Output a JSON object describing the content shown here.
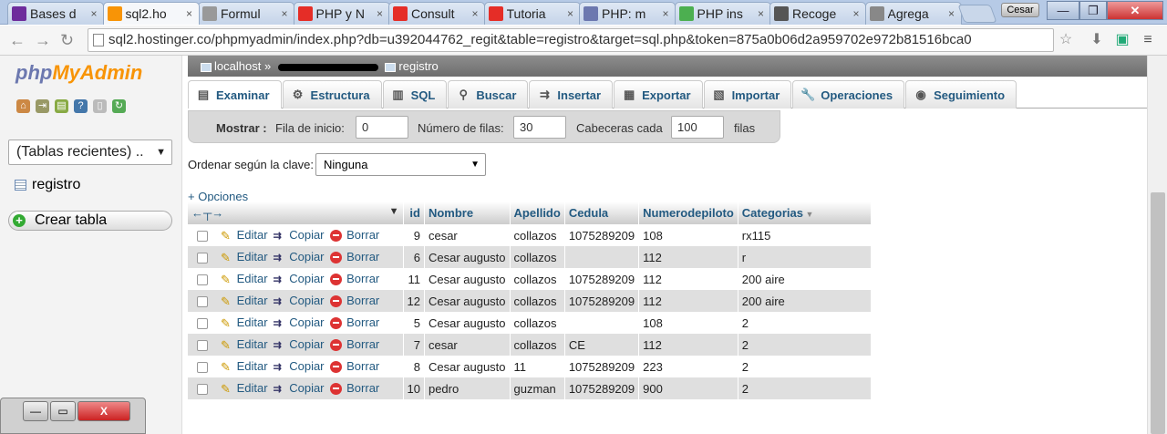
{
  "browser": {
    "tabs": [
      {
        "title": "Bases d",
        "icon": "yahoo-icon",
        "color": "#6e2c9c"
      },
      {
        "title": "sql2.ho",
        "icon": "phpmyadmin-icon",
        "color": "#f89406"
      },
      {
        "title": "Formul",
        "icon": "document-icon",
        "color": "#999999"
      },
      {
        "title": "PHP y N",
        "icon": "youtube-icon",
        "color": "#e52d27"
      },
      {
        "title": "Consult",
        "icon": "youtube-icon",
        "color": "#e52d27"
      },
      {
        "title": "Tutoria",
        "icon": "youtube-icon",
        "color": "#e52d27"
      },
      {
        "title": "PHP: m",
        "icon": "php-icon",
        "color": "#6c78af"
      },
      {
        "title": "PHP ins",
        "icon": "w3schools-icon",
        "color": "#4caf50"
      },
      {
        "title": "Recoge",
        "icon": "circle-icon",
        "color": "#555555"
      },
      {
        "title": "Agrega",
        "icon": "bracket-icon",
        "color": "#888888"
      }
    ],
    "user": "Cesar",
    "url": "sql2.hostinger.co/phpmyadmin/index.php?db=u392044762_regit&table=registro&target=sql.php&token=875a0b06d2a959702e972b81516bca0"
  },
  "sidebar": {
    "logo_php": "php",
    "logo_myadmin": "MyAdmin",
    "recent_tables": "(Tablas recientes) ..",
    "table_item": "registro",
    "create_table": "Crear tabla",
    "close_x": "X"
  },
  "breadcrumb": {
    "server": "localhost",
    "sep": "»",
    "table": "registro"
  },
  "tabs": [
    {
      "label": "Examinar",
      "icon": "browse-icon"
    },
    {
      "label": "Estructura",
      "icon": "structure-icon"
    },
    {
      "label": "SQL",
      "icon": "sql-icon"
    },
    {
      "label": "Buscar",
      "icon": "search-icon"
    },
    {
      "label": "Insertar",
      "icon": "insert-icon"
    },
    {
      "label": "Exportar",
      "icon": "export-icon"
    },
    {
      "label": "Importar",
      "icon": "import-icon"
    },
    {
      "label": "Operaciones",
      "icon": "wrench-icon"
    },
    {
      "label": "Seguimiento",
      "icon": "eye-icon"
    }
  ],
  "navigation": {
    "show_label": "Mostrar :",
    "start_label": "Fila de inicio:",
    "start_value": "0",
    "rows_label": "Número de filas:",
    "rows_value": "30",
    "headers_label": "Cabeceras cada",
    "headers_value": "100",
    "rows_suffix": "filas"
  },
  "sort": {
    "label": "Ordenar según la clave:",
    "value": "Ninguna"
  },
  "options_link": "+ Opciones",
  "grid": {
    "columns": [
      "id",
      "Nombre",
      "Apellido",
      "Cedula",
      "Numerodepiloto",
      "Categorias"
    ],
    "actions": {
      "edit": "Editar",
      "copy": "Copiar",
      "delete": "Borrar"
    },
    "rows": [
      {
        "id": "9",
        "nombre": "cesar",
        "apellido": "collazos",
        "cedula": "1075289209",
        "piloto": "108",
        "categorias": "rx115"
      },
      {
        "id": "6",
        "nombre": "Cesar augusto",
        "apellido": "collazos",
        "cedula": "",
        "piloto": "112",
        "categorias": "r"
      },
      {
        "id": "11",
        "nombre": "Cesar augusto",
        "apellido": "collazos",
        "cedula": "1075289209",
        "piloto": "112",
        "categorias": "200 aire"
      },
      {
        "id": "12",
        "nombre": "Cesar augusto",
        "apellido": "collazos",
        "cedula": "1075289209",
        "piloto": "112",
        "categorias": "200 aire"
      },
      {
        "id": "5",
        "nombre": "Cesar augusto",
        "apellido": "collazos",
        "cedula": "",
        "piloto": "108",
        "categorias": "2"
      },
      {
        "id": "7",
        "nombre": "cesar",
        "apellido": "collazos",
        "cedula": "CE",
        "piloto": "112",
        "categorias": "2"
      },
      {
        "id": "8",
        "nombre": "Cesar augusto",
        "apellido": "11",
        "cedula": "1075289209",
        "piloto": "223",
        "categorias": "2"
      },
      {
        "id": "10",
        "nombre": "pedro",
        "apellido": "guzman",
        "cedula": "1075289209",
        "piloto": "900",
        "categorias": "2"
      }
    ]
  }
}
